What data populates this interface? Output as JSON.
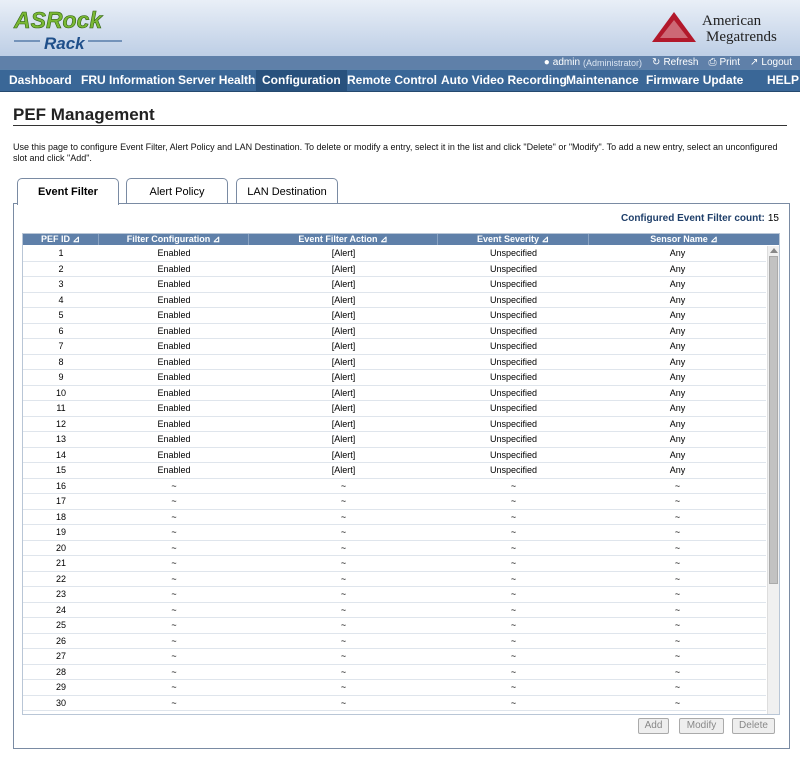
{
  "brand": {
    "left_logo_top": "ASRock",
    "left_logo_bottom": "Rack",
    "right_logo_line1": "American",
    "right_logo_line2": "Megatrends"
  },
  "userbar": {
    "user": "admin",
    "role": "(Administrator)",
    "refresh": "Refresh",
    "print": "Print",
    "logout": "Logout"
  },
  "nav": [
    "Dashboard",
    "FRU Information",
    "Server Health",
    "Configuration",
    "Remote Control",
    "Auto Video Recording",
    "Maintenance",
    "Firmware Update",
    "HELP"
  ],
  "nav_active": "Configuration",
  "page": {
    "title": "PEF Management",
    "description": "Use this page to configure Event Filter, Alert Policy and LAN Destination. To delete or modify a entry, select it in the list and click \"Delete\" or \"Modify\". To add a new entry, select an unconfigured slot and click \"Add\"."
  },
  "tabs": [
    "Event Filter",
    "Alert Policy",
    "LAN Destination"
  ],
  "active_tab": "Event Filter",
  "count": {
    "label": "Configured Event Filter count:",
    "value": "15"
  },
  "table": {
    "columns": [
      "PEF ID",
      "Filter Configuration",
      "Event Filter Action",
      "Event Severity",
      "Sensor Name"
    ],
    "rows": [
      [
        "1",
        "Enabled",
        "[Alert]",
        "Unspecified",
        "Any"
      ],
      [
        "2",
        "Enabled",
        "[Alert]",
        "Unspecified",
        "Any"
      ],
      [
        "3",
        "Enabled",
        "[Alert]",
        "Unspecified",
        "Any"
      ],
      [
        "4",
        "Enabled",
        "[Alert]",
        "Unspecified",
        "Any"
      ],
      [
        "5",
        "Enabled",
        "[Alert]",
        "Unspecified",
        "Any"
      ],
      [
        "6",
        "Enabled",
        "[Alert]",
        "Unspecified",
        "Any"
      ],
      [
        "7",
        "Enabled",
        "[Alert]",
        "Unspecified",
        "Any"
      ],
      [
        "8",
        "Enabled",
        "[Alert]",
        "Unspecified",
        "Any"
      ],
      [
        "9",
        "Enabled",
        "[Alert]",
        "Unspecified",
        "Any"
      ],
      [
        "10",
        "Enabled",
        "[Alert]",
        "Unspecified",
        "Any"
      ],
      [
        "11",
        "Enabled",
        "[Alert]",
        "Unspecified",
        "Any"
      ],
      [
        "12",
        "Enabled",
        "[Alert]",
        "Unspecified",
        "Any"
      ],
      [
        "13",
        "Enabled",
        "[Alert]",
        "Unspecified",
        "Any"
      ],
      [
        "14",
        "Enabled",
        "[Alert]",
        "Unspecified",
        "Any"
      ],
      [
        "15",
        "Enabled",
        "[Alert]",
        "Unspecified",
        "Any"
      ],
      [
        "16",
        "~",
        "~",
        "~",
        "~"
      ],
      [
        "17",
        "~",
        "~",
        "~",
        "~"
      ],
      [
        "18",
        "~",
        "~",
        "~",
        "~"
      ],
      [
        "19",
        "~",
        "~",
        "~",
        "~"
      ],
      [
        "20",
        "~",
        "~",
        "~",
        "~"
      ],
      [
        "21",
        "~",
        "~",
        "~",
        "~"
      ],
      [
        "22",
        "~",
        "~",
        "~",
        "~"
      ],
      [
        "23",
        "~",
        "~",
        "~",
        "~"
      ],
      [
        "24",
        "~",
        "~",
        "~",
        "~"
      ],
      [
        "25",
        "~",
        "~",
        "~",
        "~"
      ],
      [
        "26",
        "~",
        "~",
        "~",
        "~"
      ],
      [
        "27",
        "~",
        "~",
        "~",
        "~"
      ],
      [
        "28",
        "~",
        "~",
        "~",
        "~"
      ],
      [
        "29",
        "~",
        "~",
        "~",
        "~"
      ],
      [
        "30",
        "~",
        "~",
        "~",
        "~"
      ]
    ]
  },
  "buttons": {
    "add": "Add",
    "modify": "Modify",
    "delete": "Delete"
  },
  "icons": {
    "sort": "sort-icon",
    "user": "user-icon",
    "refresh": "refresh-icon",
    "print": "print-icon",
    "logout": "logout-icon"
  },
  "colors": {
    "nav_bg": "#3a6797",
    "header_bg": "#c9d7ea",
    "grid_header": "#5f80a9",
    "logo_green": "#7ab834",
    "logo_blue": "#1f4f8a",
    "ami_red": "#b2182b"
  }
}
